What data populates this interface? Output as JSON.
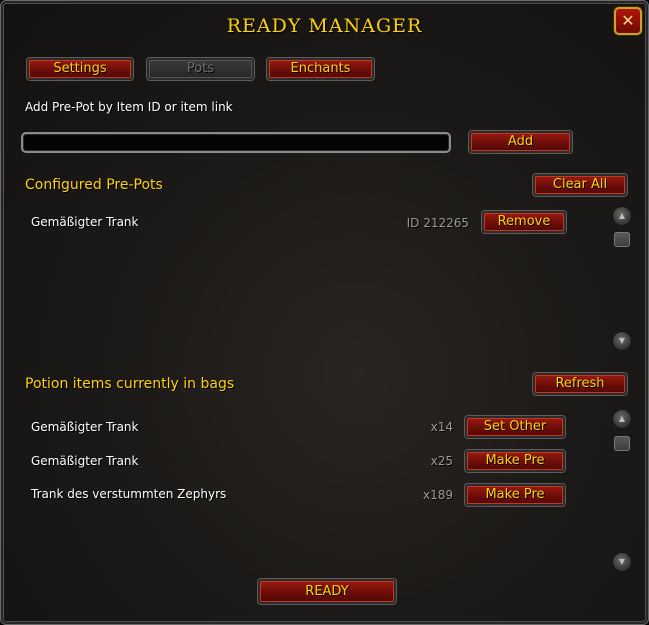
{
  "window": {
    "title": "READY MANAGER",
    "close_glyph": "✕"
  },
  "tabs": [
    {
      "label": "Settings",
      "state": "active"
    },
    {
      "label": "Pots",
      "state": "disabled"
    },
    {
      "label": "Enchants",
      "state": "active"
    }
  ],
  "add_section": {
    "prompt": "Add Pre-Pot by Item ID or item link",
    "input_value": "",
    "add_label": "Add"
  },
  "configured": {
    "heading": "Configured Pre-Pots",
    "clear_label": "Clear All",
    "items": [
      {
        "name": "Gemäßigter Trank",
        "id_text": "ID 212265",
        "action": "Remove"
      }
    ]
  },
  "bags": {
    "heading": "Potion items currently in bags",
    "refresh_label": "Refresh",
    "items": [
      {
        "name": "Gemäßigter Trank",
        "count": "x14",
        "action": "Set Other"
      },
      {
        "name": "Gemäßigter Trank",
        "count": "x25",
        "action": "Make Pre"
      },
      {
        "name": "Trank des verstummten Zephyrs",
        "count": "x189",
        "action": "Make Pre"
      }
    ]
  },
  "footer": {
    "ready_label": "READY"
  },
  "icons": {
    "scroll_up": "▲",
    "scroll_down": "▼"
  },
  "colors": {
    "gold": "#ffd100",
    "button_red": "#8a150d",
    "background": "#1c1a18"
  }
}
